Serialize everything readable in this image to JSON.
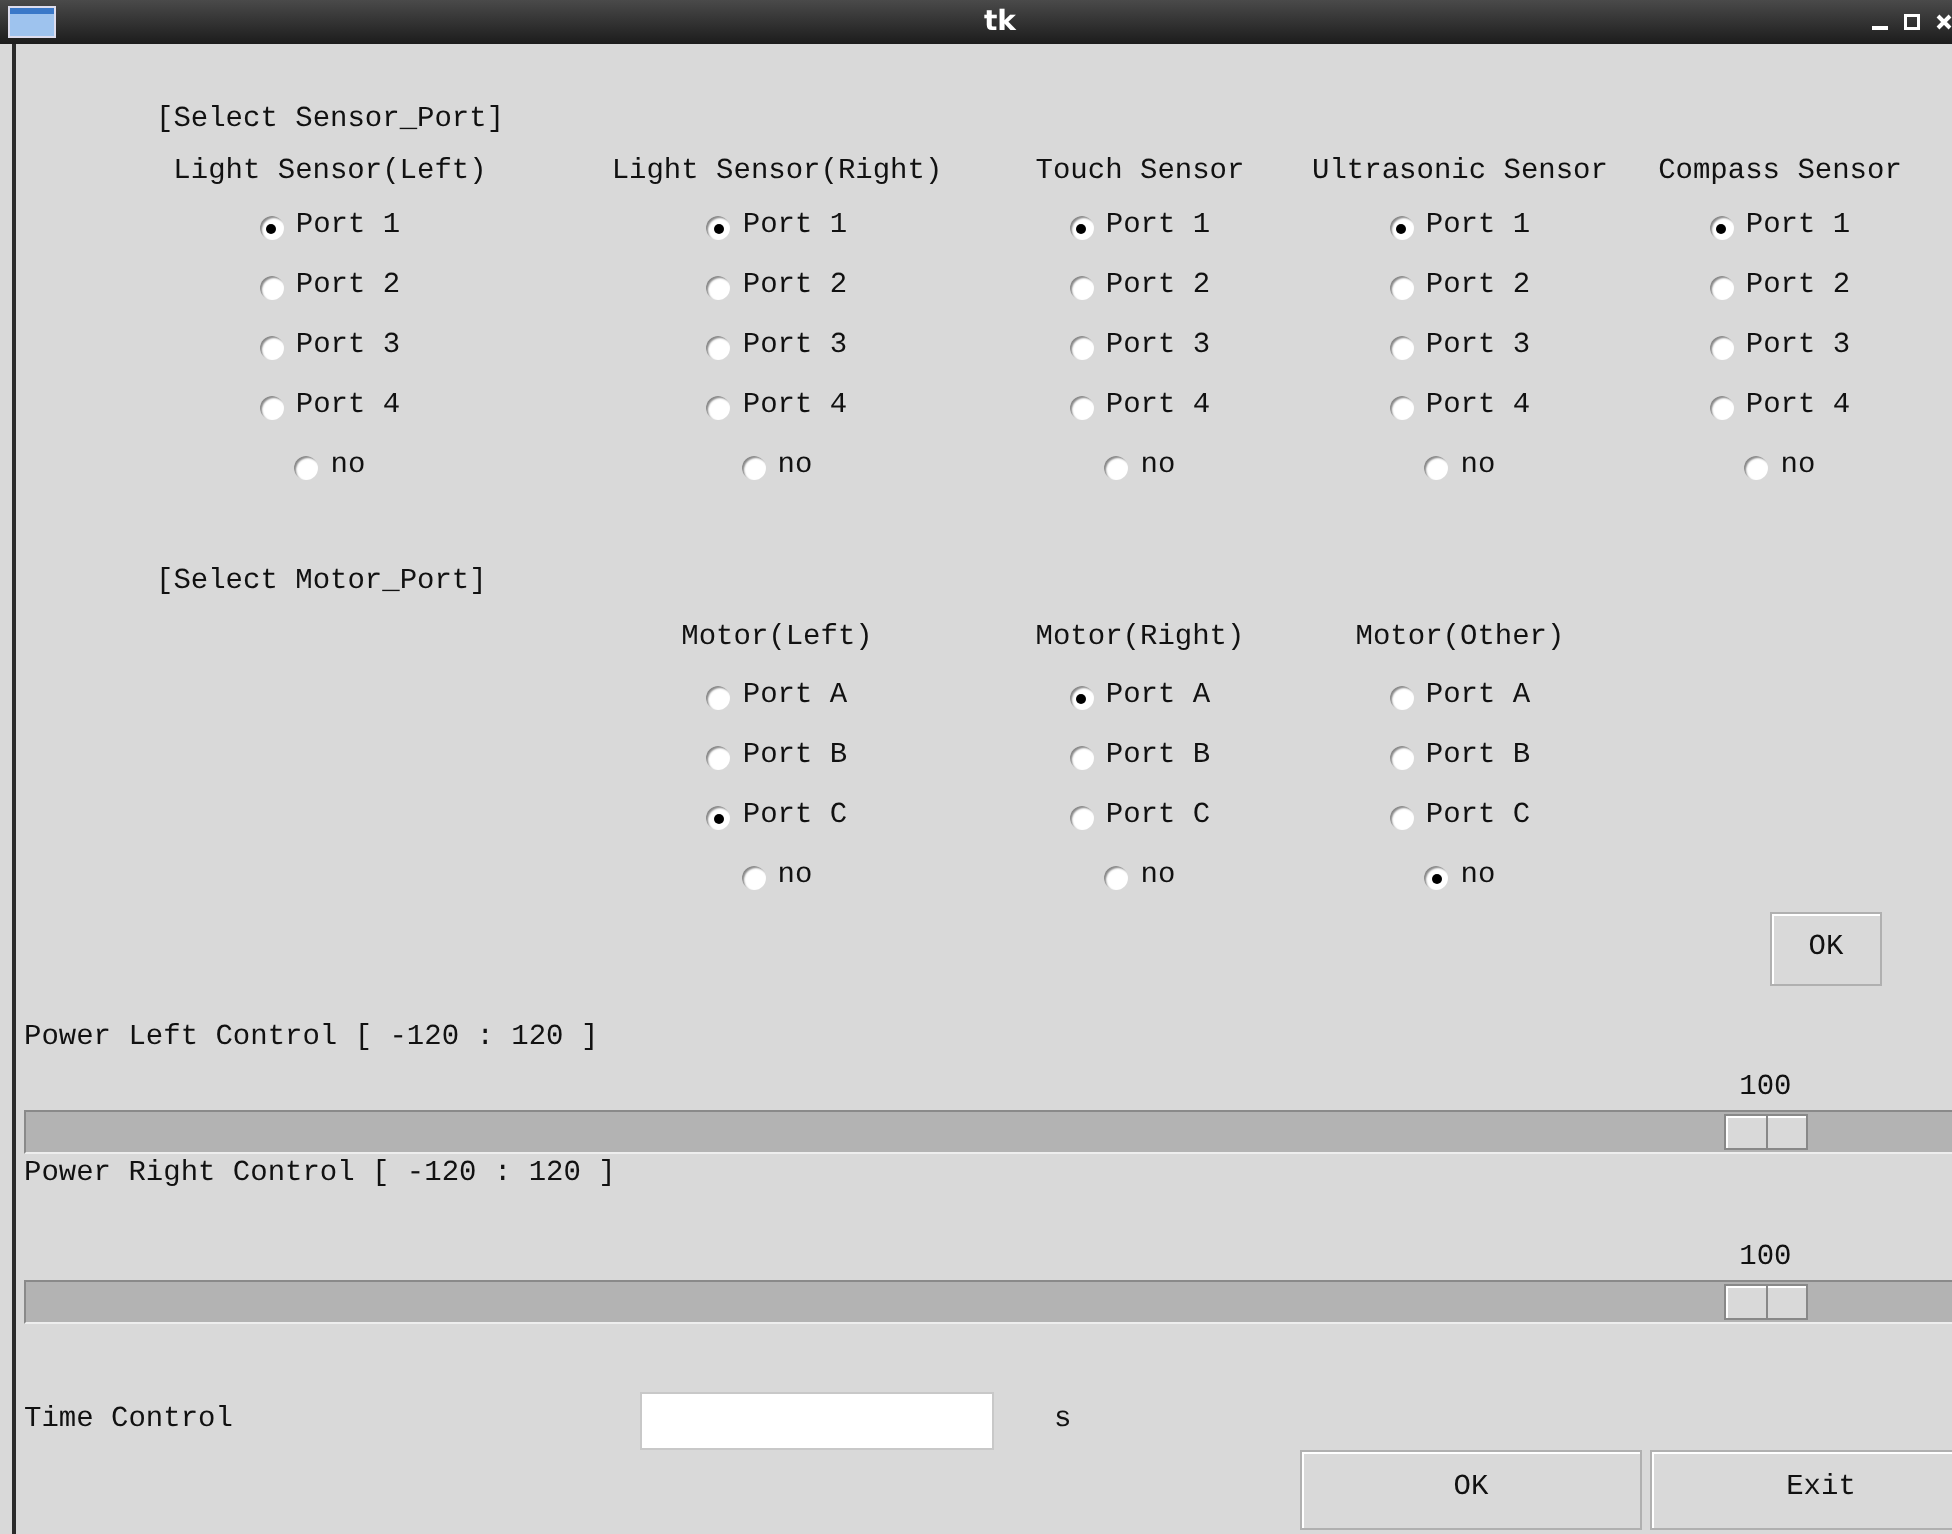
{
  "window": {
    "title": "tk"
  },
  "sensor_section": {
    "title": "[Select Sensor_Port]",
    "groups": [
      {
        "label": "Light Sensor(Left)",
        "options": [
          {
            "label": "Port 1",
            "selected": true
          },
          {
            "label": "Port 2",
            "selected": false
          },
          {
            "label": "Port 3",
            "selected": false
          },
          {
            "label": "Port 4",
            "selected": false
          },
          {
            "label": "no",
            "selected": false
          }
        ]
      },
      {
        "label": "Light Sensor(Right)",
        "options": [
          {
            "label": "Port 1",
            "selected": true
          },
          {
            "label": "Port 2",
            "selected": false
          },
          {
            "label": "Port 3",
            "selected": false
          },
          {
            "label": "Port 4",
            "selected": false
          },
          {
            "label": "no",
            "selected": false
          }
        ]
      },
      {
        "label": "Touch Sensor",
        "options": [
          {
            "label": "Port 1",
            "selected": true
          },
          {
            "label": "Port 2",
            "selected": false
          },
          {
            "label": "Port 3",
            "selected": false
          },
          {
            "label": "Port 4",
            "selected": false
          },
          {
            "label": "no",
            "selected": false
          }
        ]
      },
      {
        "label": "Ultrasonic Sensor",
        "options": [
          {
            "label": "Port 1",
            "selected": true
          },
          {
            "label": "Port 2",
            "selected": false
          },
          {
            "label": "Port 3",
            "selected": false
          },
          {
            "label": "Port 4",
            "selected": false
          },
          {
            "label": "no",
            "selected": false
          }
        ]
      },
      {
        "label": "Compass Sensor",
        "options": [
          {
            "label": "Port 1",
            "selected": true
          },
          {
            "label": "Port 2",
            "selected": false
          },
          {
            "label": "Port 3",
            "selected": false
          },
          {
            "label": "Port 4",
            "selected": false
          },
          {
            "label": "no",
            "selected": false
          }
        ]
      }
    ]
  },
  "motor_section": {
    "title": "[Select Motor_Port]",
    "groups": [
      {
        "label": "Motor(Left)",
        "options": [
          {
            "label": "Port A",
            "selected": false
          },
          {
            "label": "Port B",
            "selected": false
          },
          {
            "label": "Port C",
            "selected": true
          },
          {
            "label": "no",
            "selected": false
          }
        ]
      },
      {
        "label": "Motor(Right)",
        "options": [
          {
            "label": "Port A",
            "selected": true
          },
          {
            "label": "Port B",
            "selected": false
          },
          {
            "label": "Port C",
            "selected": false
          },
          {
            "label": "no",
            "selected": false
          }
        ]
      },
      {
        "label": "Motor(Other)",
        "options": [
          {
            "label": "Port A",
            "selected": false
          },
          {
            "label": "Port B",
            "selected": false
          },
          {
            "label": "Port C",
            "selected": false
          },
          {
            "label": "no",
            "selected": true
          }
        ]
      }
    ],
    "ok_button": "OK"
  },
  "power_controls": [
    {
      "label": "Power Left Control [ -120 : 120 ]",
      "reading": "100",
      "level": 0.917
    },
    {
      "label": "Power Right Control [ -120 : 120 ]",
      "reading": "100",
      "level": 0.917
    }
  ],
  "time_control": {
    "label": "Time Control",
    "unit": "s"
  },
  "buttons": [
    "OK",
    "Exit"
  ]
}
